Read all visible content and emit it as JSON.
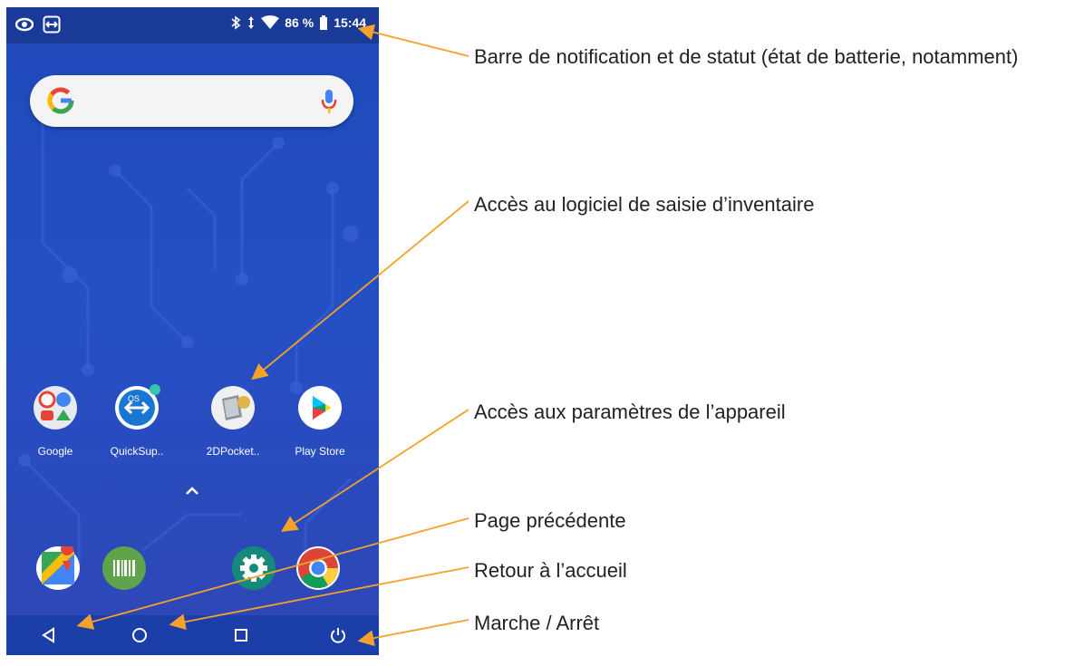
{
  "status_bar": {
    "left_icons": [
      "eye-icon",
      "cast-icon"
    ],
    "right_icons": [
      "bluetooth-icon",
      "data-arrows-icon",
      "wifi-icon"
    ],
    "battery": "86 %",
    "time": "15:44"
  },
  "search": {
    "logo": "google-g-icon",
    "mic": "mic-icon"
  },
  "apps": [
    {
      "label": "Google",
      "icon": "google-folder-icon"
    },
    {
      "label": "QuickSup..",
      "icon": "quicksupport-icon"
    },
    {
      "label": "2DPocket..",
      "icon": "2dpocket-icon"
    },
    {
      "label": "Play Store",
      "icon": "play-store-icon"
    }
  ],
  "dock": [
    "maps-icon",
    "barcode-icon",
    "settings-icon",
    "chrome-icon"
  ],
  "navbar": [
    "back-icon",
    "home-icon",
    "recents-icon",
    "power-icon"
  ],
  "annotations": [
    {
      "text": "Barre de notification et de statut (état de batterie, notamment)"
    },
    {
      "text": "Accès au logiciel de saisie d’inventaire"
    },
    {
      "text": "Accès aux paramètres de l’appareil"
    },
    {
      "text": "Page précédente"
    },
    {
      "text": "Retour à l’accueil"
    },
    {
      "text": "Marche / Arrêt"
    }
  ],
  "colors": {
    "accent_arrow": "#f5a12a",
    "wallpaper": "#2450c6"
  }
}
